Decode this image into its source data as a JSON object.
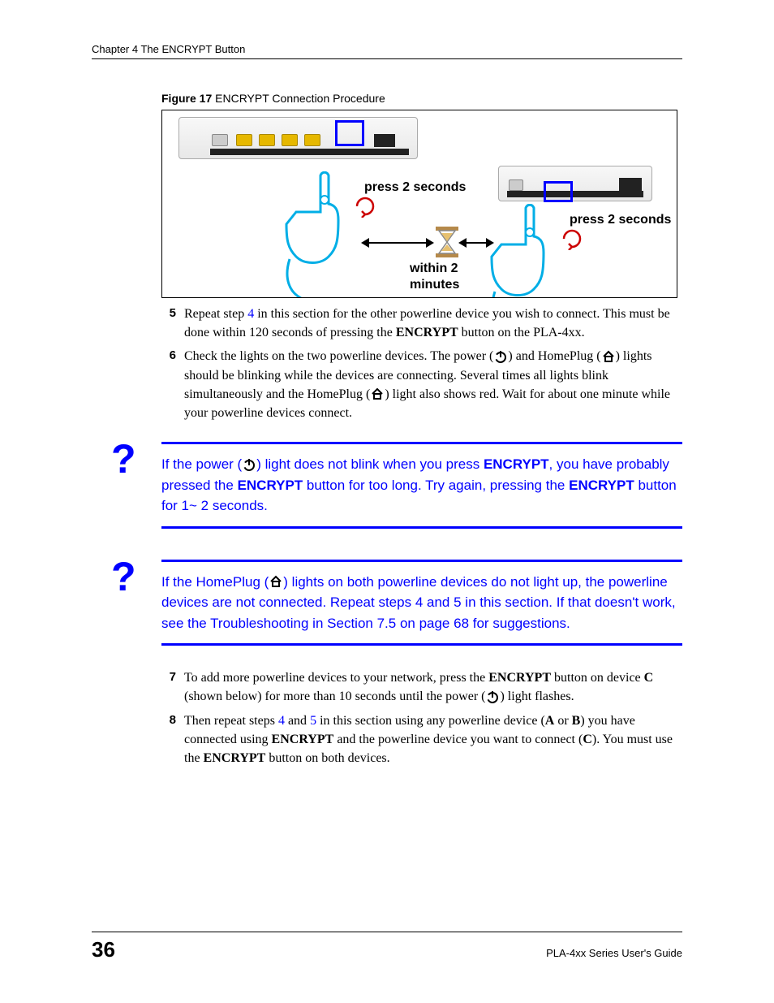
{
  "header": {
    "chapter": "Chapter 4 The ENCRYPT Button"
  },
  "figure": {
    "labelBold": "Figure 17",
    "labelRest": "   ENCRYPT Connection Procedure",
    "press1": "press 2 seconds",
    "press2": "press 2 seconds",
    "within1": "within 2",
    "within2": "minutes"
  },
  "steps": {
    "s5_num": "5",
    "s5_a": "Repeat step ",
    "s5_xref": "4",
    "s5_b": " in this section for the other powerline device you wish to connect. This must be done within 120 seconds of pressing the ",
    "s5_c": "ENCRYPT",
    "s5_d": " button on the PLA-4xx.",
    "s6_num": "6",
    "s6_a": "Check the lights on the two powerline devices. The power (",
    "s6_b": ") and HomePlug (",
    "s6_c": ") lights should be blinking while the devices are connecting. Several times all lights blink simultaneously and the HomePlug (",
    "s6_d": ") light also shows red. Wait for about one minute while your powerline devices connect.",
    "s7_num": "7",
    "s7_a": "To add more powerline devices to your network, press the ",
    "s7_enc": "ENCRYPT",
    "s7_b": " button on device ",
    "s7_devC": "C",
    "s7_c": " (shown below) for more than 10 seconds until the power (",
    "s7_d": ") light flashes.",
    "s8_num": "8",
    "s8_a": "Then repeat steps ",
    "s8_x4": "4",
    "s8_and": " and ",
    "s8_x5": "5",
    "s8_b": " in this section using any powerline device (",
    "s8_devA": "A",
    "s8_or": " or ",
    "s8_devB": "B",
    "s8_c": ") you have connected using ",
    "s8_enc": "ENCRYPT",
    "s8_d": " and the powerline device you want to connect (",
    "s8_devC": "C",
    "s8_e": "). You must use the ",
    "s8_enc2": "ENCRYPT",
    "s8_f": " button on both devices."
  },
  "tip1": {
    "a": "If the power (",
    "b": ") light does not blink when you press ",
    "enc1": "ENCRYPT",
    "c": ", you have probably pressed the ",
    "enc2": "ENCRYPT",
    "d": " button for too long. Try again, pressing the ",
    "enc3": "ENCRYPT",
    "e": " button for 1~ 2 seconds."
  },
  "tip2": {
    "a": "If the HomePlug (",
    "b": ") lights on both powerline devices do not light up, the powerline devices are not connected. Repeat steps ",
    "x4": "4",
    "and": " and ",
    "x5": "5",
    "c": " in this section. If that doesn't work, see the Troubleshooting in ",
    "sec": "Section 7.5 on page 68",
    "d": " for suggestions."
  },
  "footer": {
    "page": "36",
    "guide": "PLA-4xx Series User's Guide"
  },
  "icons": {
    "power": "power-icon",
    "homeplug": "homeplug-icon",
    "question": "?"
  }
}
